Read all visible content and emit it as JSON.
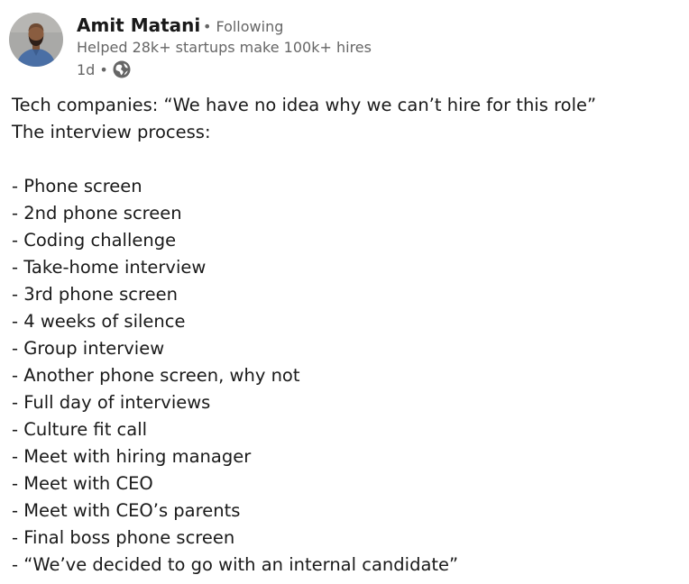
{
  "author": {
    "name": "Amit Matani",
    "follow_status": "Following",
    "headline": "Helped 28k+ startups make 100k+ hires",
    "timestamp": "1d",
    "separator": "•",
    "avatar_icon": "profile-photo",
    "visibility_icon": "globe-icon"
  },
  "post": {
    "intro": "Tech companies: “We have no idea why we can’t hire for this role”",
    "subtitle": "The interview process:",
    "items": [
      "- Phone screen",
      "- 2nd phone screen",
      "- Coding challenge",
      "- Take-home interview",
      "- 3rd phone screen",
      "- 4 weeks of silence",
      "- Group interview",
      "- Another phone screen, why not",
      "- Full day of interviews",
      "- Culture fit call",
      "- Meet with hiring manager",
      "- Meet with CEO",
      "- Meet with CEO’s parents",
      "- Final boss phone screen",
      "- “We’ve decided to go with an internal candidate”"
    ]
  },
  "colors": {
    "text_primary": "#191919",
    "text_secondary": "#666666",
    "avatar_background": "#a9a9a7",
    "avatar_shirt": "#4a6fa5",
    "globe": "#666666"
  }
}
